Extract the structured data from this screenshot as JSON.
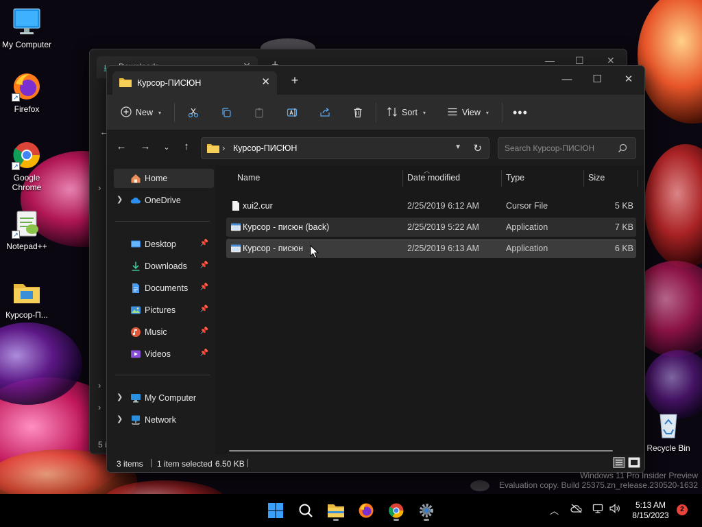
{
  "desktop": {
    "icons": [
      {
        "label": "My Computer"
      },
      {
        "label": "Firefox"
      },
      {
        "label": "Google Chrome"
      },
      {
        "label": "Notepad++"
      },
      {
        "label": "Курсор-П..."
      },
      {
        "label": "Recycle Bin"
      }
    ]
  },
  "back_window": {
    "tab_title": "Downloads",
    "status": "5 i"
  },
  "window": {
    "tab_title": "Курсор-ПИСЮН",
    "toolbar": {
      "new_label": "New",
      "sort_label": "Sort",
      "view_label": "View"
    },
    "address": {
      "path": "Курсор-ПИСЮН",
      "search_placeholder": "Search Курсор-ПИСЮН"
    },
    "nav": {
      "home": "Home",
      "onedrive": "OneDrive",
      "pinned": [
        {
          "label": "Desktop"
        },
        {
          "label": "Downloads"
        },
        {
          "label": "Documents"
        },
        {
          "label": "Pictures"
        },
        {
          "label": "Music"
        },
        {
          "label": "Videos"
        }
      ],
      "my_computer": "My Computer",
      "network": "Network"
    },
    "columns": {
      "name": "Name",
      "date": "Date modified",
      "type": "Type",
      "size": "Size"
    },
    "files": [
      {
        "name": "xui2.cur",
        "date": "2/25/2019 6:12 AM",
        "type": "Cursor File",
        "size": "5 KB"
      },
      {
        "name": "Курсор - писюн (back)",
        "date": "2/25/2019 5:22 AM",
        "type": "Application",
        "size": "7 KB"
      },
      {
        "name": "Курсор - писюн",
        "date": "2/25/2019 6:13 AM",
        "type": "Application",
        "size": "6 KB"
      }
    ],
    "status": {
      "items": "3 items",
      "selected": "1 item selected",
      "size": "6.50 KB"
    }
  },
  "watermark": {
    "line1": "Windows 11 Pro Insider Preview",
    "line2": "Evaluation copy. Build 25375.zn_release.230520-1632"
  },
  "taskbar": {
    "time": "5:13 AM",
    "date": "8/15/2023",
    "notification_count": "2"
  },
  "colors": {
    "accent": "#0078d4",
    "folder": "#f2c94c",
    "selection": "#3c3c3c"
  }
}
